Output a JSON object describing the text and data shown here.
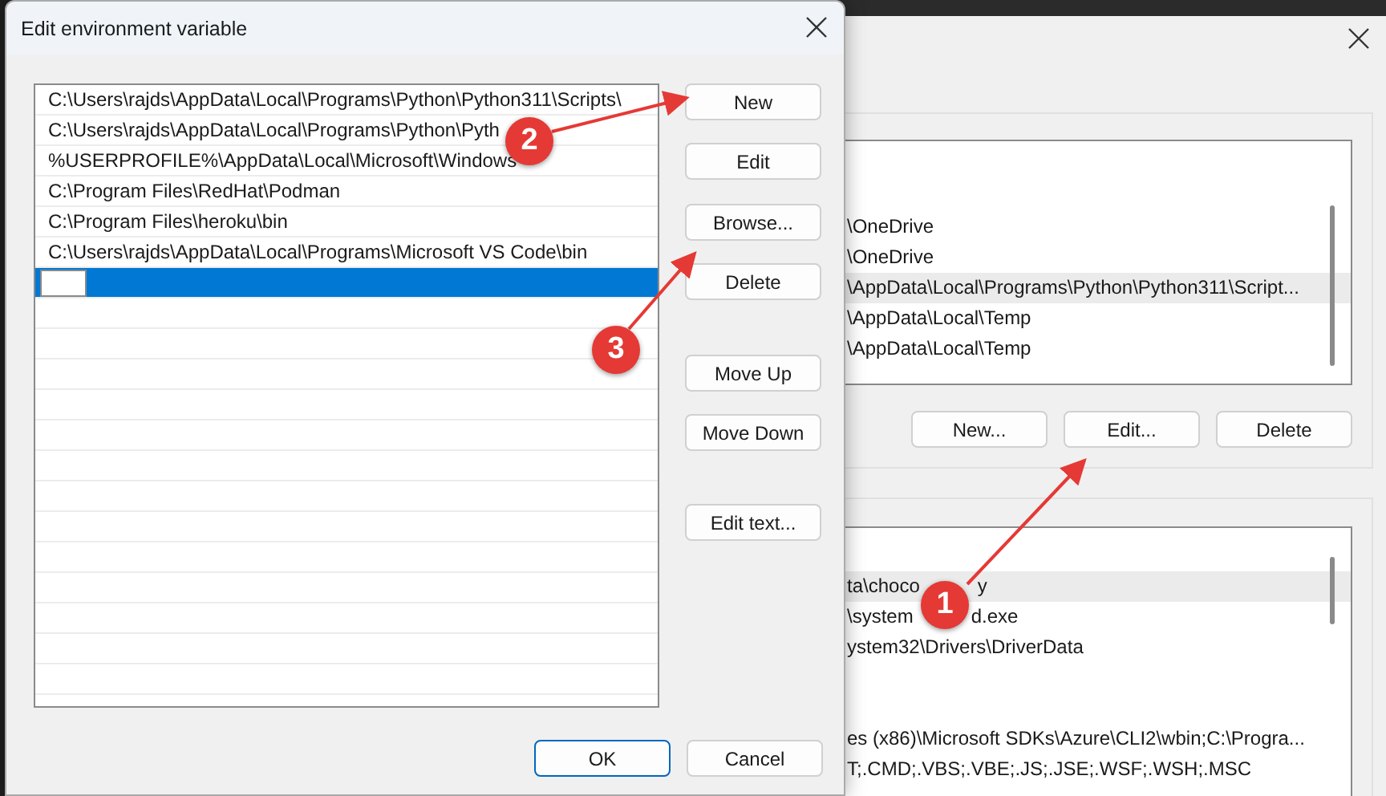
{
  "edit_dialog": {
    "title": "Edit environment variable",
    "entries": [
      {
        "text": "C:\\Users\\rajds\\AppData\\Local\\Programs\\Python\\Python311\\Scripts\\",
        "selected": false
      },
      {
        "text": "C:\\Users\\rajds\\AppData\\Local\\Programs\\Python\\Pyth",
        "selected": false
      },
      {
        "text": "%USERPROFILE%\\AppData\\Local\\Microsoft\\Windows",
        "selected": false
      },
      {
        "text": "C:\\Program Files\\RedHat\\Podman",
        "selected": false
      },
      {
        "text": "C:\\Program Files\\heroku\\bin",
        "selected": false
      },
      {
        "text": "C:\\Users\\rajds\\AppData\\Local\\Programs\\Microsoft VS Code\\bin",
        "selected": false
      },
      {
        "selected": true,
        "editing": true
      }
    ],
    "side_buttons": [
      {
        "label": "New"
      },
      {
        "label": "Edit"
      },
      {
        "label": "Browse..."
      },
      {
        "label": "Delete"
      },
      {
        "label": "Move Up"
      },
      {
        "label": "Move Down"
      },
      {
        "label": "Edit text..."
      }
    ],
    "footer_buttons": [
      {
        "label": "OK",
        "default": true
      },
      {
        "label": "Cancel",
        "default": false
      }
    ]
  },
  "background_dialog": {
    "user_variables": [
      {
        "selected": false
      },
      {
        "selected": false
      },
      {
        "text": "\\OneDrive",
        "selected": false
      },
      {
        "text": "\\OneDrive",
        "selected": false
      },
      {
        "text": "\\AppData\\Local\\Programs\\Python\\Python311\\Script...",
        "selected": true
      },
      {
        "text": "\\AppData\\Local\\Temp",
        "selected": false
      },
      {
        "text": "\\AppData\\Local\\Temp",
        "selected": false
      }
    ],
    "user_buttons": [
      {
        "label": "New..."
      },
      {
        "label": "Edit..."
      },
      {
        "label": "Delete"
      }
    ],
    "system_variables": [
      {
        "selected": false
      },
      {
        "text": "ta\\choco",
        "tail": "y",
        "selected": true
      },
      {
        "text": "\\system",
        "tail": "d.exe",
        "selected": false
      },
      {
        "text": "ystem32\\Drivers\\DriverData",
        "selected": false
      },
      {
        "selected": false
      },
      {
        "selected": false
      },
      {
        "text": "es (x86)\\Microsoft SDKs\\Azure\\CLI2\\wbin;C:\\Progra...",
        "selected": false
      },
      {
        "text": "T;.CMD;.VBS;.VBE;.JS;.JSE;.WSF;.WSH;.MSC",
        "selected": false
      }
    ]
  },
  "annotations": [
    {
      "number": "2"
    },
    {
      "number": "3"
    },
    {
      "number": "1"
    }
  ]
}
